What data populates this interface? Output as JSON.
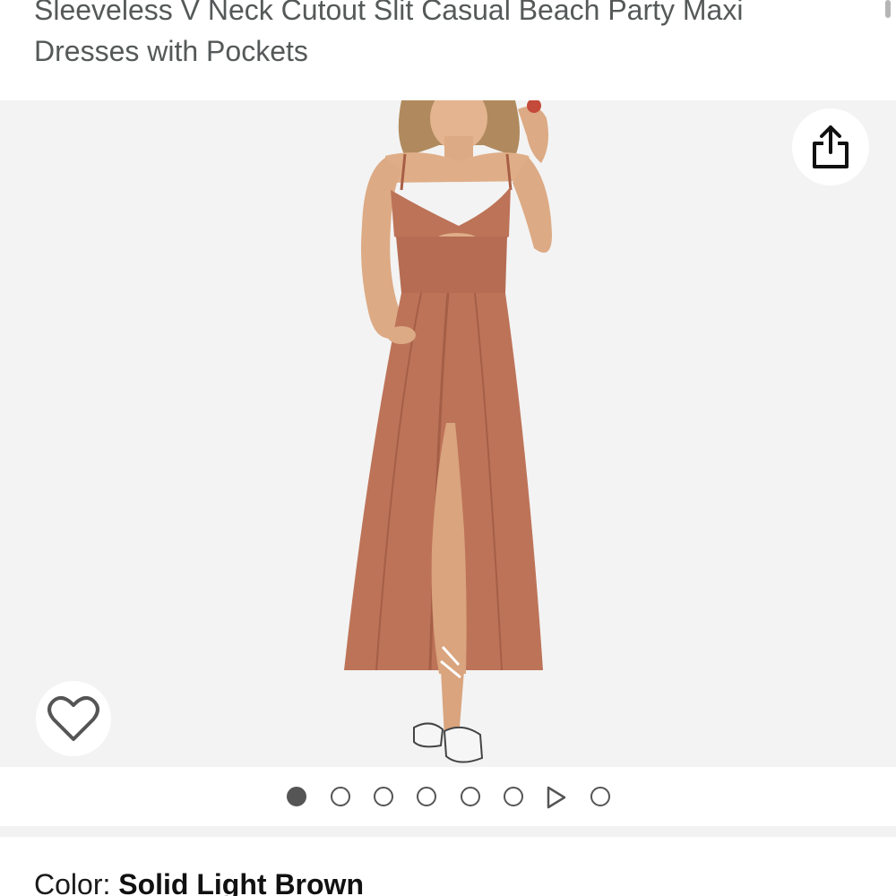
{
  "product": {
    "title_lines": [
      "",
      "Sleeveless V Neck Cutout Slit Casual Beach Party Maxi",
      "Dresses with Pockets"
    ]
  },
  "gallery": {
    "image_subject": "woman in light brown sleeveless V-neck cutout slit maxi dress",
    "share_icon": "share-icon",
    "wishlist_icon": "heart-outline-icon",
    "dots_total": 8,
    "active_index": 0,
    "video_index": 6
  },
  "color": {
    "label": "Color: ",
    "value": "Solid Light Brown"
  },
  "colors": {
    "dress": "#bd7358",
    "background": "#f3f3f3",
    "text_muted": "#565959"
  }
}
